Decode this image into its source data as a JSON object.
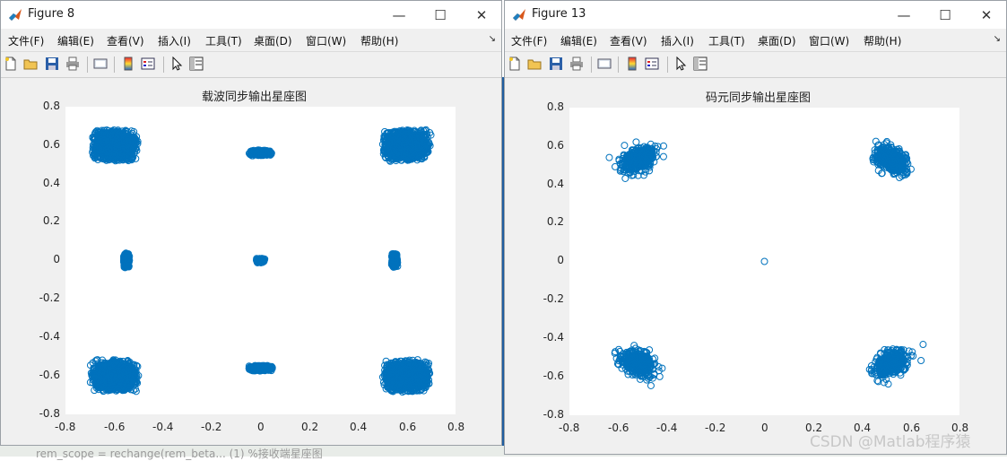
{
  "background": {
    "code_text": "    rem_scope  = rechange(rem_beta...  (1)      %接收端星座图",
    "watermark": "CSDN @Matlab程序猿"
  },
  "windows": [
    {
      "title": "Figure 8",
      "menu": [
        "文件(F)",
        "编辑(E)",
        "查看(V)",
        "插入(I)",
        "工具(T)",
        "桌面(D)",
        "窗口(W)",
        "帮助(H)"
      ],
      "controls": {
        "minimize": "—",
        "maximize": "☐",
        "close": "✕"
      },
      "plot": {
        "title": "载波同步输出星座图",
        "xticks": [
          "-0.8",
          "-0.6",
          "-0.4",
          "-0.2",
          "0",
          "0.2",
          "0.4",
          "0.6",
          "0.8"
        ],
        "yticks": [
          "0.8",
          "0.6",
          "0.4",
          "0.2",
          "0",
          "-0.2",
          "-0.4",
          "-0.6",
          "-0.8"
        ]
      }
    },
    {
      "title": "Figure 13",
      "menu": [
        "文件(F)",
        "编辑(E)",
        "查看(V)",
        "插入(I)",
        "工具(T)",
        "桌面(D)",
        "窗口(W)",
        "帮助(H)"
      ],
      "controls": {
        "minimize": "—",
        "maximize": "☐",
        "close": "✕"
      },
      "plot": {
        "title": "码元同步输出星座图",
        "xticks": [
          "-0.8",
          "-0.6",
          "-0.4",
          "-0.2",
          "0",
          "0.2",
          "0.4",
          "0.6",
          "0.8"
        ],
        "yticks": [
          "0.8",
          "0.6",
          "0.4",
          "0.2",
          "0",
          "-0.2",
          "-0.4",
          "-0.6",
          "-0.8"
        ]
      }
    }
  ],
  "toolbar_icons": [
    "new-file-icon",
    "open-folder-icon",
    "save-icon",
    "print-icon",
    "print-preview-icon",
    "link-plot-icon",
    "insert-legend-icon",
    "pointer-icon",
    "property-inspector-icon"
  ],
  "chart_data": [
    {
      "type": "scatter",
      "title": "载波同步输出星座图",
      "xlim": [
        -0.8,
        0.8
      ],
      "ylim": [
        -0.8,
        0.8
      ],
      "marker": "open-circle",
      "color": "#0072BD",
      "grid": false,
      "clusters": [
        {
          "x": -0.6,
          "y": 0.6,
          "x_spread": 0.2,
          "y_spread": 0.17,
          "shape": "blob"
        },
        {
          "x": 0.6,
          "y": 0.6,
          "x_spread": 0.2,
          "y_spread": 0.17,
          "shape": "blob"
        },
        {
          "x": -0.6,
          "y": -0.6,
          "x_spread": 0.2,
          "y_spread": 0.17,
          "shape": "blob"
        },
        {
          "x": 0.6,
          "y": -0.6,
          "x_spread": 0.2,
          "y_spread": 0.17,
          "shape": "blob"
        },
        {
          "x": 0.0,
          "y": 0.56,
          "x_spread": 0.1,
          "y_spread": 0.03,
          "shape": "blob"
        },
        {
          "x": 0.0,
          "y": -0.56,
          "x_spread": 0.1,
          "y_spread": 0.03,
          "shape": "blob"
        },
        {
          "x": -0.55,
          "y": 0.0,
          "x_spread": 0.025,
          "y_spread": 0.08,
          "shape": "blob"
        },
        {
          "x": 0.55,
          "y": 0.0,
          "x_spread": 0.025,
          "y_spread": 0.08,
          "shape": "blob"
        },
        {
          "x": 0.0,
          "y": 0.0,
          "x_spread": 0.035,
          "y_spread": 0.025,
          "shape": "blob"
        }
      ]
    },
    {
      "type": "scatter",
      "title": "码元同步输出星座图",
      "xlim": [
        -0.8,
        0.8
      ],
      "ylim": [
        -0.8,
        0.8
      ],
      "marker": "open-circle",
      "color": "#0072BD",
      "grid": false,
      "clusters": [
        {
          "x": -0.52,
          "y": 0.53,
          "x_spread": 0.09,
          "y_spread": 0.06,
          "shape": "ellipse",
          "angle": 45
        },
        {
          "x": 0.52,
          "y": 0.53,
          "x_spread": 0.09,
          "y_spread": 0.06,
          "shape": "ellipse",
          "angle": -45
        },
        {
          "x": -0.52,
          "y": -0.53,
          "x_spread": 0.09,
          "y_spread": 0.06,
          "shape": "ellipse",
          "angle": -45
        },
        {
          "x": 0.52,
          "y": -0.53,
          "x_spread": 0.09,
          "y_spread": 0.06,
          "shape": "ellipse",
          "angle": 45
        },
        {
          "x": 0.0,
          "y": 0.0,
          "x_spread": 0.0,
          "y_spread": 0.0,
          "shape": "single"
        }
      ]
    }
  ]
}
